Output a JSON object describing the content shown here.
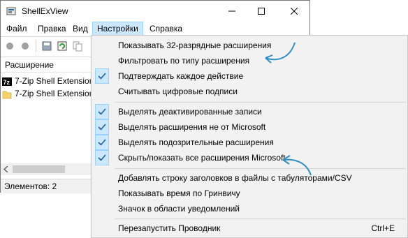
{
  "window": {
    "title": "ShellExView",
    "icon": "shellexview-app-icon"
  },
  "menubar": {
    "items": [
      "Файл",
      "Правка",
      "Вид",
      "Настройки",
      "Справка"
    ],
    "active_index": 3
  },
  "list": {
    "column_header": "Расширение",
    "rows": [
      {
        "name": "7-Zip Shell Extension",
        "icon": "7zip-icon"
      },
      {
        "name": "7-Zip Shell Extension",
        "icon": "folder-icon"
      }
    ]
  },
  "status": {
    "text": "Элементов: 2"
  },
  "dropdown": {
    "items": [
      {
        "label": "Показывать 32-разрядные расширения",
        "checked": false
      },
      {
        "label": "Фильтровать по типу расширения",
        "checked": false
      },
      {
        "label": "Подтверждать каждое действие",
        "checked": true
      },
      {
        "label": "Считывать цифровые подписи",
        "checked": false
      },
      {
        "label": "Выделять деактивированные записи",
        "checked": true
      },
      {
        "label": "Выделять расширения не от Microsoft",
        "checked": true
      },
      {
        "label": "Выделять подозрительные расширения",
        "checked": true
      },
      {
        "label": "Скрыть/показать все расширения Microsoft",
        "checked": true
      },
      {
        "label": "Добавлять строку заголовков в файлы с табуляторами/CSV",
        "checked": false
      },
      {
        "label": "Показывать время по Гринвичу",
        "checked": false
      },
      {
        "label": "Значок в области уведомлений",
        "checked": false
      },
      {
        "label": "Перезапустить Проводник",
        "checked": false,
        "shortcut": "Ctrl+E"
      }
    ]
  },
  "colors": {
    "check_bg": "#cce8ff",
    "check_border": "#99d1ff",
    "check_mark": "#1a5ea8",
    "annotation_arrow": "#2b8fc6"
  }
}
